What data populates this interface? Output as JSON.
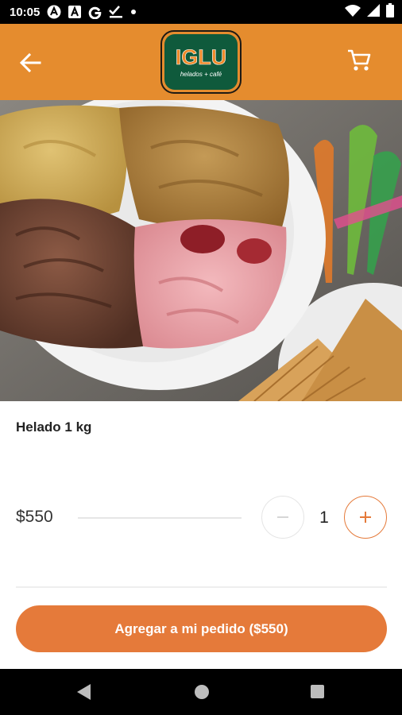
{
  "status_bar": {
    "time": "10:05",
    "icons": [
      "app-a-icon",
      "font-a-icon",
      "google-g-icon",
      "checklist-icon",
      "dot-icon"
    ],
    "right_icons": [
      "wifi-icon",
      "signal-icon",
      "battery-icon"
    ]
  },
  "app_bar": {
    "logo_text": "IGLU",
    "logo_tagline": "helados + café",
    "icons": [
      "arrow-back-icon",
      "shopping-cart-icon"
    ],
    "background_color": "#E58C2E"
  },
  "product": {
    "name": "Helado 1 kg",
    "price": "$550",
    "quantity": "1"
  },
  "cta": {
    "label": "Agregar a mi pedido ($550)",
    "color": "#E57A3A"
  },
  "nav_bar": {
    "icons": [
      "nav-back-icon",
      "nav-home-icon",
      "nav-recents-icon"
    ]
  }
}
